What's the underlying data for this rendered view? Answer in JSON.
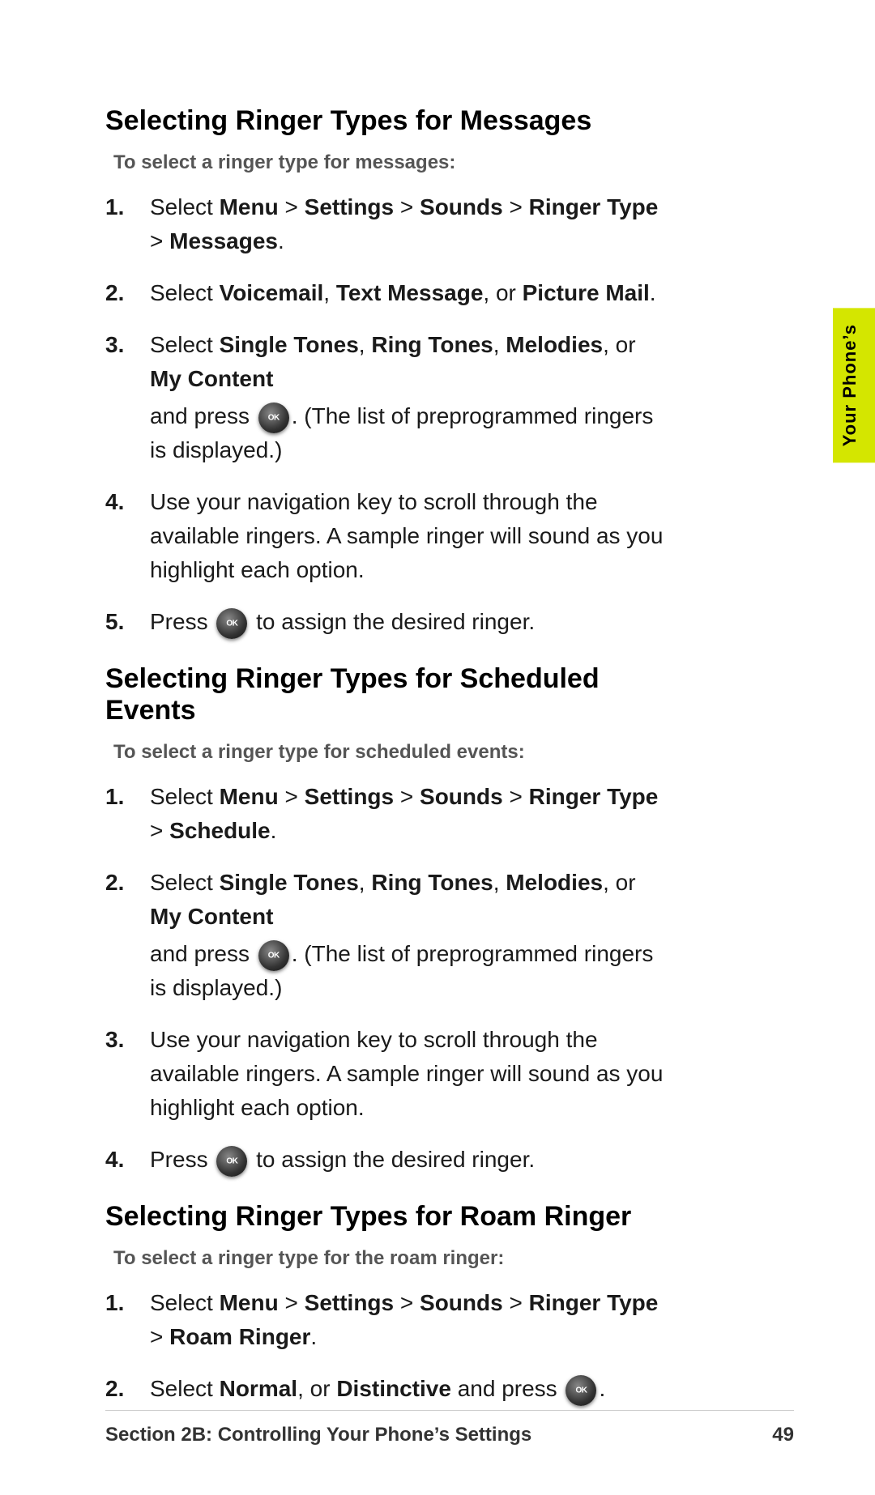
{
  "sections": [
    {
      "id": "messages",
      "title": "Selecting Ringer Types for Messages",
      "intro": "To select a ringer type for messages:",
      "steps": [
        {
          "number": "1.",
          "html": "Select <b>Menu</b> > <b>Settings</b> > <b>Sounds</b> > <b>Ringer Type</b> > <b>Messages</b>."
        },
        {
          "number": "2.",
          "html": "Select <b>Voicemail</b>, <b>Text Message</b>, or <b>Picture Mail</b>."
        },
        {
          "number": "3.",
          "html": "Select <b>Single Tones</b>, <b>Ring Tones</b>, <b>Melodies</b>, or <b>My Content</b>",
          "sub": "and press [OK]. (The list of preprogrammed ringers is displayed.)"
        },
        {
          "number": "4.",
          "html": "Use your navigation key to scroll through the available ringers. A sample ringer will sound as you highlight each option."
        },
        {
          "number": "5.",
          "html": "Press [OK] to assign the desired ringer."
        }
      ]
    },
    {
      "id": "scheduled",
      "title": "Selecting Ringer Types for Scheduled Events",
      "intro": "To select a ringer type for scheduled events:",
      "steps": [
        {
          "number": "1.",
          "html": "Select <b>Menu</b> > <b>Settings</b> > <b>Sounds</b> > <b>Ringer Type</b> > <b>Schedule</b>."
        },
        {
          "number": "2.",
          "html": "Select <b>Single Tones</b>, <b>Ring Tones</b>, <b>Melodies</b>, or <b>My Content</b>",
          "sub": "and press [OK]. (The list of preprogrammed ringers is displayed.)"
        },
        {
          "number": "3.",
          "html": "Use your navigation key to scroll through the available ringers. A sample ringer will sound as you highlight each option."
        },
        {
          "number": "4.",
          "html": "Press [OK] to assign the desired ringer."
        }
      ]
    },
    {
      "id": "roam",
      "title": "Selecting Ringer Types for Roam Ringer",
      "intro": "To select a ringer type for the roam ringer:",
      "steps": [
        {
          "number": "1.",
          "html": "Select <b>Menu</b> > <b>Settings</b> > <b>Sounds</b> > <b>Ringer Type</b> > <b>Roam Ringer</b>."
        },
        {
          "number": "2.",
          "html": "Select <b>Normal</b>, or <b>Distinctive</b> and press [OK]."
        }
      ]
    }
  ],
  "footer": {
    "section_label": "Section 2B: Controlling Your Phone’s Settings",
    "page_number": "49"
  },
  "side_tab": {
    "label": "Your Phone’s"
  }
}
